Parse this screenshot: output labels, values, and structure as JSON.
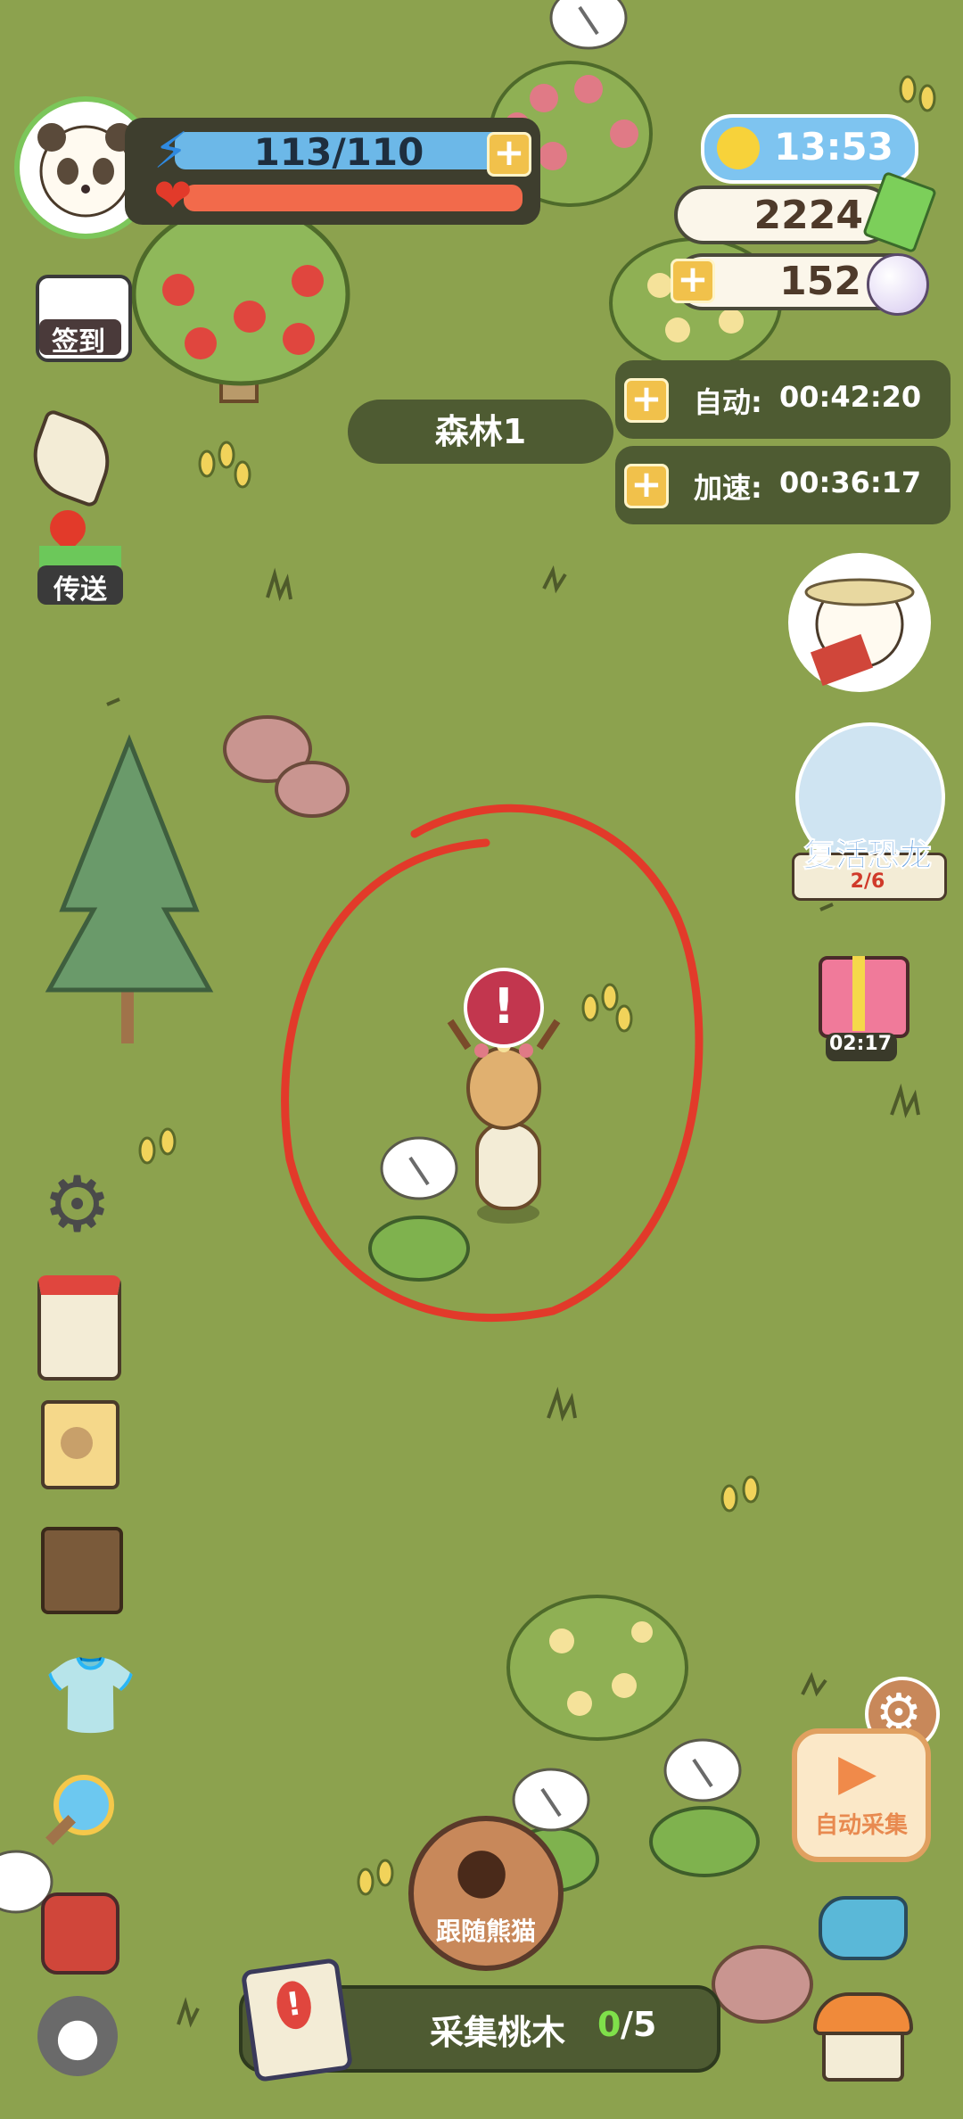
{
  "player": {
    "energy": "113/110",
    "energy_plus": "+"
  },
  "hud": {
    "time": "13:53",
    "coins": "2224",
    "pearls": "152",
    "plus": "+"
  },
  "location": "森林1",
  "timers": [
    {
      "label": "自动:",
      "value": "00:42:20"
    },
    {
      "label": "加速:",
      "value": "00:36:17"
    }
  ],
  "left_menu": {
    "signin_label": "签到",
    "teleport_label": "传送"
  },
  "right_menu": {
    "dino_label": "复活恐龙",
    "dino_progress": "2/6",
    "gift_timer": "02:17",
    "auto_collect_label": "自动采集"
  },
  "follow_button_label": "跟随熊猫",
  "quest": {
    "label": "采集桃木",
    "current": "0",
    "total": "/5"
  },
  "exclaim": "!",
  "colors": {
    "grass": "#8ca24e",
    "dark_pill": "#4e5b32",
    "energy_bar": "#6cb8e8",
    "health_bar": "#f26a4b",
    "accent_yellow": "#f1c14b",
    "dino_text": "#2f7fd6",
    "quest_progress": "#7fe04a"
  }
}
